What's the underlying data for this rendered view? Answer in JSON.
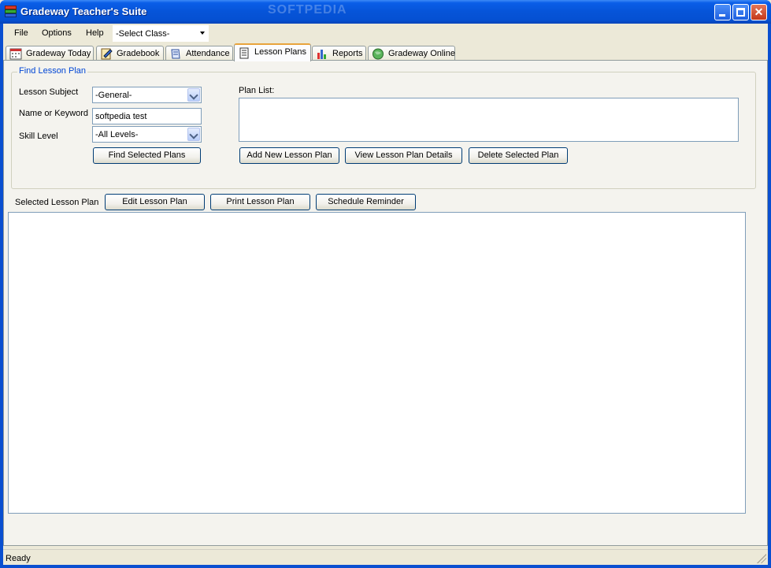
{
  "window": {
    "title": "Gradeway Teacher's Suite",
    "watermark": "SOFTPEDIA"
  },
  "menu": {
    "items": [
      "File",
      "Options",
      "Help"
    ],
    "class_select": "-Select Class-"
  },
  "tabs": [
    {
      "label": "Gradeway Today",
      "icon": "calendar-icon"
    },
    {
      "label": "Gradebook",
      "icon": "gradebook-icon"
    },
    {
      "label": "Attendance",
      "icon": "attendance-icon"
    },
    {
      "label": "Lesson Plans",
      "icon": "notebook-icon",
      "active": true
    },
    {
      "label": "Reports",
      "icon": "bar-chart-icon"
    },
    {
      "label": "Gradeway Online",
      "icon": "globe-icon"
    }
  ],
  "find": {
    "group_title": "Find Lesson Plan",
    "subject_label": "Lesson Subject",
    "subject_value": "-General-",
    "keyword_label": "Name or Keyword",
    "keyword_value": "softpedia test",
    "skill_label": "Skill Level",
    "skill_value": "-All Levels-",
    "find_button": "Find Selected Plans",
    "plan_list_label": "Plan List:",
    "add_button": "Add New Lesson Plan",
    "view_button": "View Lesson Plan Details",
    "delete_button": "Delete Selected Plan"
  },
  "selected": {
    "label": "Selected Lesson Plan",
    "edit_button": "Edit Lesson Plan",
    "print_button": "Print Lesson Plan",
    "reminder_button": "Schedule Reminder"
  },
  "status": {
    "text": "Ready"
  },
  "colors": {
    "title_bar": "#0654d8",
    "group_title": "#0046d5",
    "active_tab_accent": "#e8a33c"
  }
}
